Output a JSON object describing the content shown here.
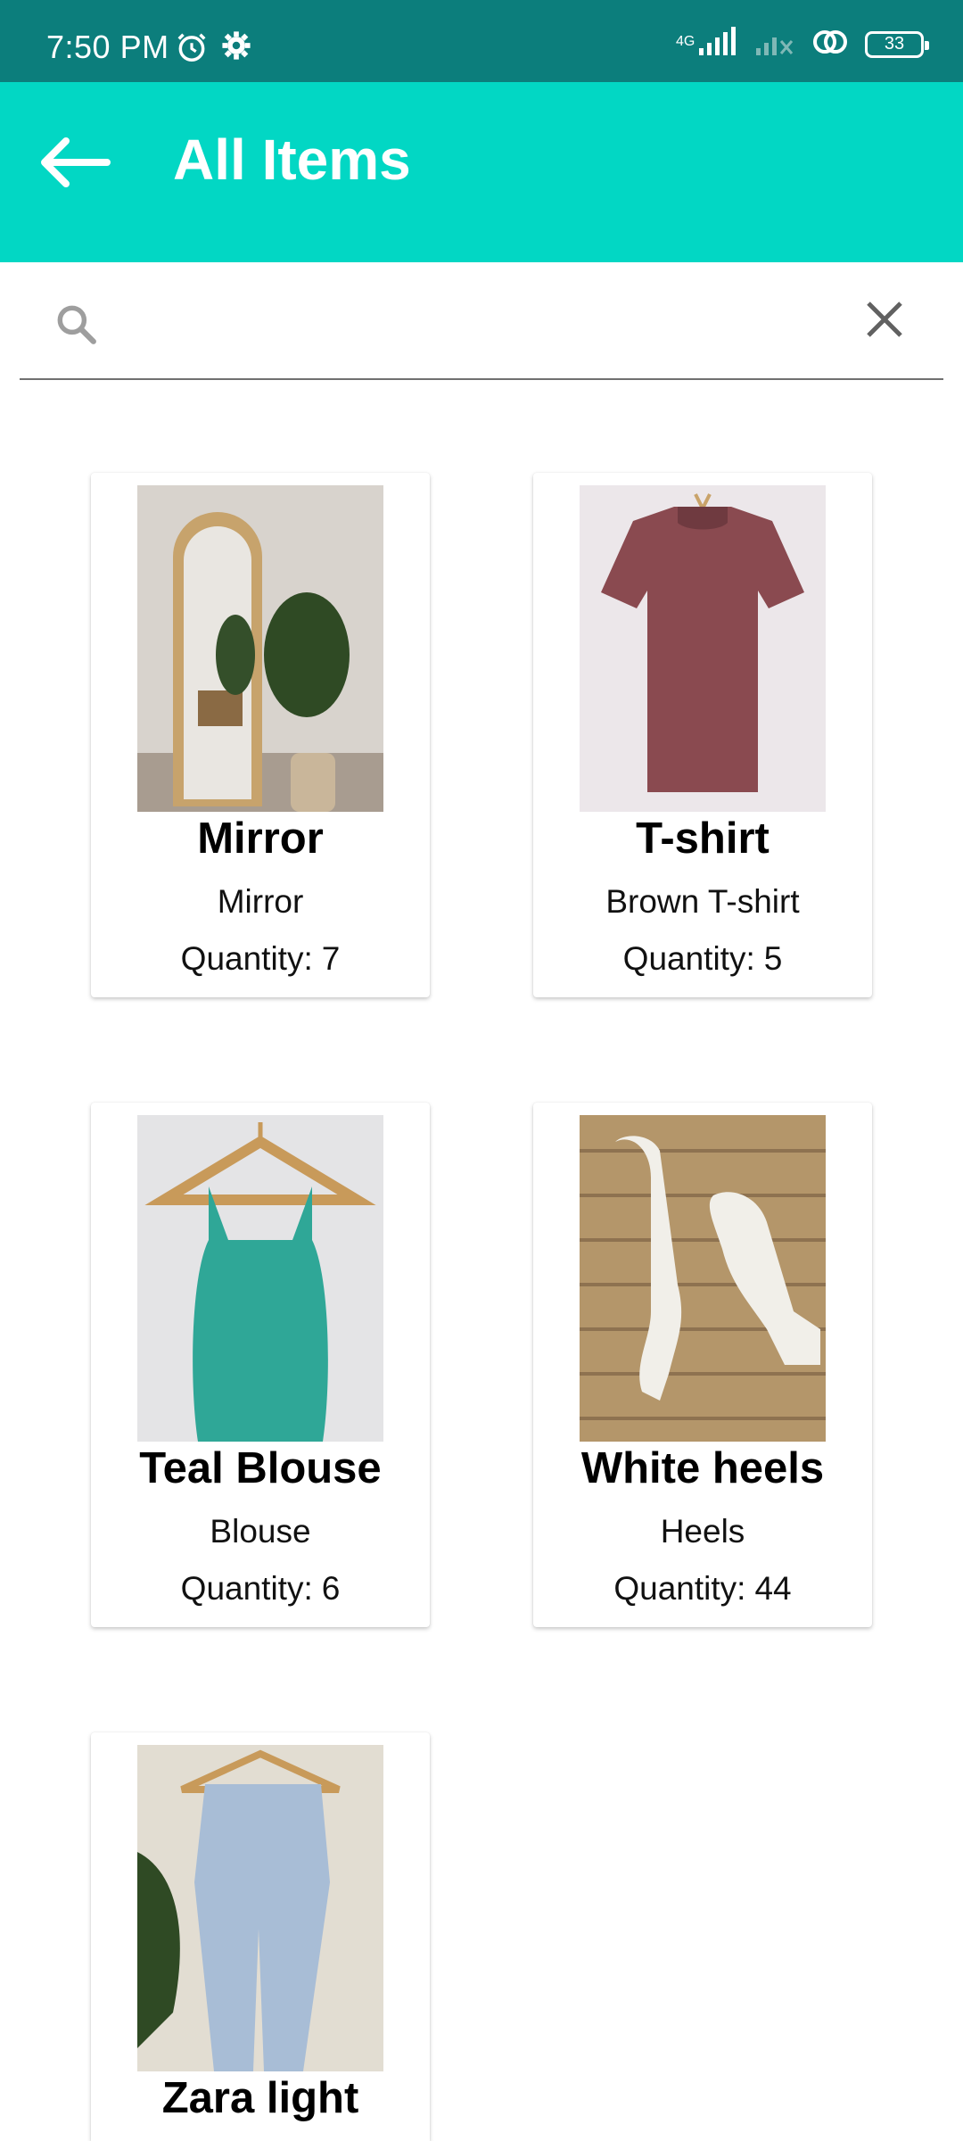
{
  "status_bar": {
    "time": "7:50 PM",
    "network": "4G",
    "battery": "33",
    "icons": [
      "alarm-icon",
      "gear-icon",
      "signal-icon",
      "signal-off-icon",
      "link-icon",
      "battery-icon"
    ]
  },
  "app_bar": {
    "title": "All Items",
    "background": "#02d7c4",
    "status_background": "#0c7e7c"
  },
  "search": {
    "value": "",
    "placeholder": ""
  },
  "items": [
    {
      "name": "Mirror",
      "description": "Mirror",
      "quantity_label": "Quantity:",
      "quantity": "7",
      "image": "mirror-photo"
    },
    {
      "name": "T-shirt",
      "description": "Brown T-shirt",
      "quantity_label": "Quantity:",
      "quantity": "5",
      "image": "tshirt-photo"
    },
    {
      "name": "Teal Blouse",
      "description": "Blouse",
      "quantity_label": "Quantity:",
      "quantity": "6",
      "image": "blouse-photo"
    },
    {
      "name": "White heels",
      "description": "Heels",
      "quantity_label": "Quantity:",
      "quantity": "44",
      "image": "heels-photo"
    },
    {
      "name": "Zara light",
      "description": "",
      "quantity_label": "",
      "quantity": "",
      "image": "jeans-photo"
    }
  ]
}
